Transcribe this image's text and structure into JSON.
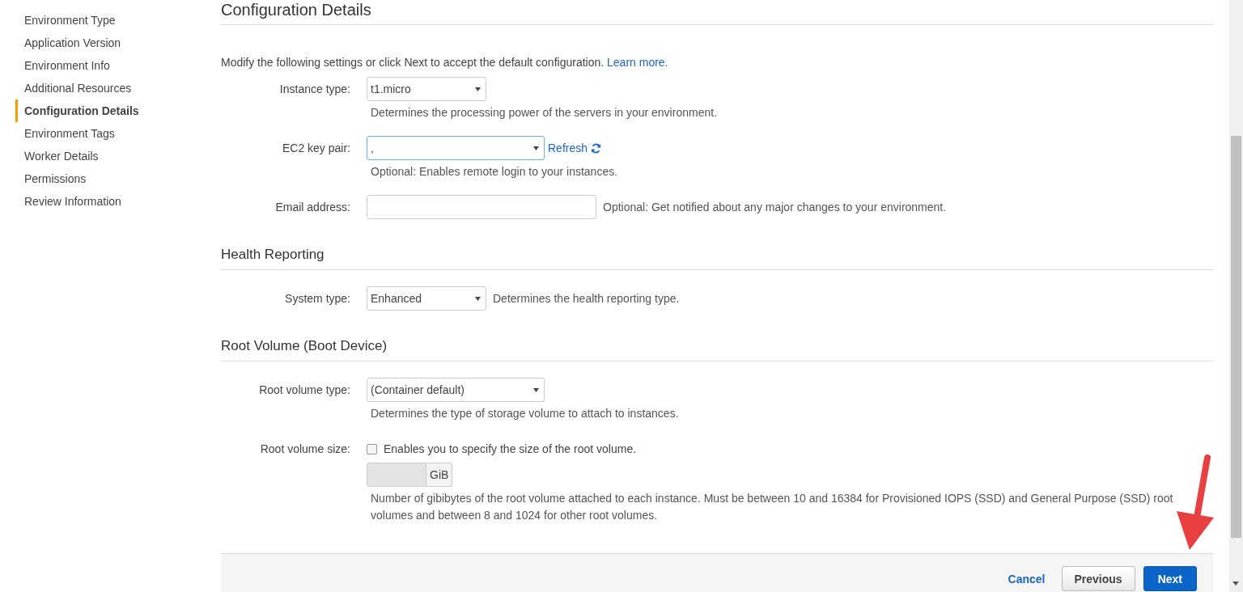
{
  "sidebar": {
    "items": [
      {
        "label": "Environment Type",
        "selected": false
      },
      {
        "label": "Application Version",
        "selected": false
      },
      {
        "label": "Environment Info",
        "selected": false
      },
      {
        "label": "Additional Resources",
        "selected": false
      },
      {
        "label": "Configuration Details",
        "selected": true
      },
      {
        "label": "Environment Tags",
        "selected": false
      },
      {
        "label": "Worker Details",
        "selected": false
      },
      {
        "label": "Permissions",
        "selected": false
      },
      {
        "label": "Review Information",
        "selected": false
      }
    ]
  },
  "page_title": "Configuration Details",
  "intro": {
    "text": "Modify the following settings or click Next to accept the default configuration.",
    "link": "Learn more."
  },
  "sections": [
    {
      "fields": [
        {
          "kind": "select",
          "label": "Instance type:",
          "value": "t1.micro",
          "focused": false,
          "help": "Determines the processing power of the servers in your environment.",
          "help_inline": false
        },
        {
          "kind": "select",
          "label": "EC2 key pair:",
          "value": ",",
          "focused": true,
          "refresh": "Refresh",
          "help": "Optional: Enables remote login to your instances.",
          "help_inline": false
        },
        {
          "kind": "text",
          "label": "Email address:",
          "help": "Optional: Get notified about any major changes to your environment.",
          "help_inline": true
        }
      ]
    },
    {
      "title": "Health Reporting",
      "fields": [
        {
          "kind": "select",
          "label": "System type:",
          "value": "Enhanced",
          "focused": false,
          "help": "Determines the health reporting type.",
          "help_inline": true
        }
      ]
    },
    {
      "title": "Root Volume (Boot Device)",
      "fields": [
        {
          "kind": "select",
          "label": "Root volume type:",
          "value": "(Container default)",
          "focused": false,
          "help": "Determines the type of storage volume to attach to instances.",
          "help_inline": false
        },
        {
          "kind": "checkbox",
          "label": "Root volume size:",
          "checked": false,
          "check_label": "Enables you to specify the size of the root volume.",
          "unit": "GiB",
          "disabled": true,
          "help": "Number of gibibytes of the root volume attached to each instance. Must be between 10 and 16384 for Provisioned IOPS (SSD) and General Purpose (SSD) root volumes and between 8 and 1024 for other root volumes.",
          "help_inline": false
        }
      ]
    }
  ],
  "footer": {
    "cancel": "Cancel",
    "previous": "Previous",
    "next": "Next"
  }
}
